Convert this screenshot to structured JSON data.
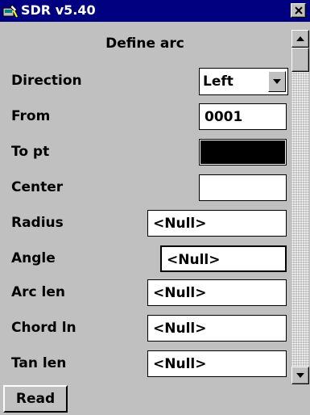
{
  "window": {
    "title": "SDR v5.40",
    "icon": "app-icon",
    "close_icon": "close-icon"
  },
  "form": {
    "heading": "Define arc",
    "direction": {
      "label": "Direction",
      "value": "Left"
    },
    "from": {
      "label": "From",
      "value": "0001"
    },
    "to_pt": {
      "label": "To pt",
      "value": ""
    },
    "center": {
      "label": "Center",
      "value": ""
    },
    "radius": {
      "label": "Radius",
      "value": "<Null>"
    },
    "angle": {
      "label": "Angle",
      "value": "<Null>"
    },
    "arc_len": {
      "label": "Arc len",
      "value": "<Null>"
    },
    "chord_ln": {
      "label": "Chord ln",
      "value": "<Null>"
    },
    "tan_len": {
      "label": "Tan len",
      "value": "<Null>"
    }
  },
  "buttons": {
    "read": "Read"
  },
  "colors": {
    "titlebar": "#000080",
    "face": "#c0c0c0",
    "field": "#ffffff",
    "selected_field": "#000000"
  }
}
